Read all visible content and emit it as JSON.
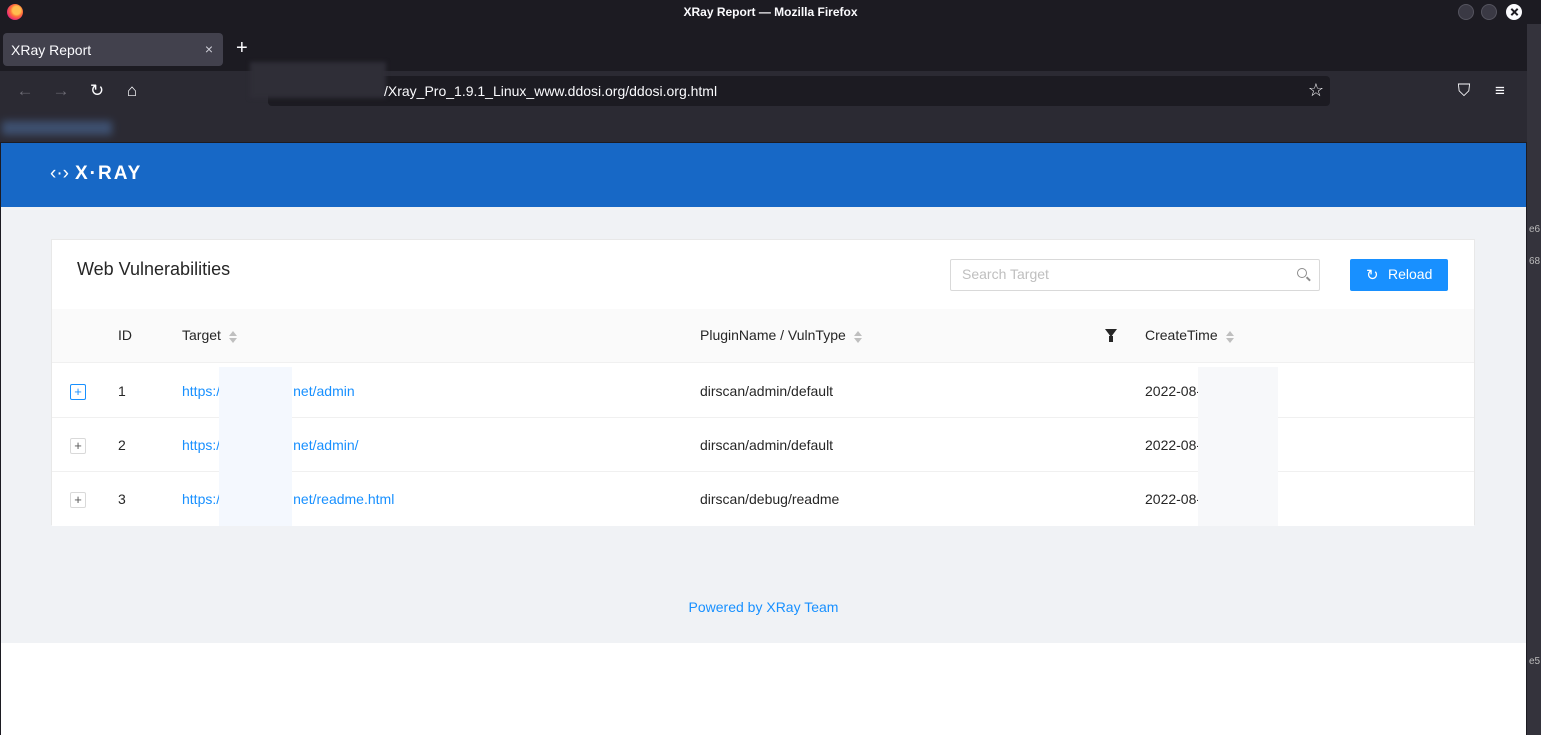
{
  "window": {
    "title": "XRay Report — Mozilla Firefox"
  },
  "tabs": [
    {
      "label": "XRay Report",
      "close": "×"
    }
  ],
  "new_tab": "+",
  "navbar": {
    "url": "/Xray_Pro_1.9.1_Linux_www.ddosi.org/ddosi.org.html",
    "back": "←",
    "forward": "→",
    "reload": "↻",
    "home": "⌂",
    "star": "☆",
    "pocket": "⛉",
    "menu": "≡"
  },
  "app": {
    "logo": "X·RAY",
    "logo_mark": "‹·›"
  },
  "card": {
    "title": "Web Vulnerabilities",
    "search_placeholder": "Search Target",
    "reload_label": "Reload",
    "reload_icon": "↻"
  },
  "table": {
    "columns": {
      "id": "ID",
      "target": "Target",
      "plugin": "PluginName / VulnType",
      "time": "CreateTime"
    },
    "rows": [
      {
        "expand": "+",
        "id": "1",
        "target_prefix": "https:/",
        "target_suffix": "net/admin",
        "plugin": "dirscan/admin/default",
        "time": "2022-08-"
      },
      {
        "expand": "+",
        "id": "2",
        "target_prefix": "https:/",
        "target_suffix": "net/admin/",
        "plugin": "dirscan/admin/default",
        "time": "2022-08-"
      },
      {
        "expand": "+",
        "id": "3",
        "target_prefix": "https:/",
        "target_suffix": "net/readme.html",
        "plugin": "dirscan/debug/readme",
        "time": "2022-08-"
      }
    ]
  },
  "footer": "Powered by XRay Team",
  "right_edge": [
    "e6",
    "68",
    "e5"
  ]
}
